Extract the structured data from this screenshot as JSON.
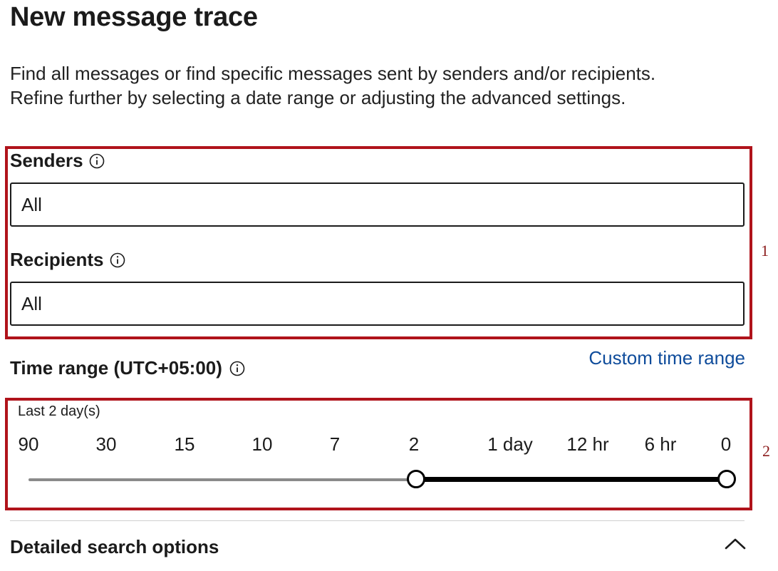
{
  "page_title": "New message trace",
  "description": {
    "line1": "Find all messages or find specific messages sent by senders and/or recipients.",
    "line2": "Refine further by selecting a date range or adjusting the advanced settings."
  },
  "senders": {
    "label": "Senders",
    "value": "All"
  },
  "recipients": {
    "label": "Recipients",
    "value": "All"
  },
  "time_range": {
    "label": "Time range (UTC+05:00)",
    "custom_link": "Custom time range",
    "selected_text": "Last 2 day(s)",
    "ticks": [
      "90",
      "30",
      "15",
      "10",
      "7",
      "2",
      "1 day",
      "12 hr",
      "6 hr",
      "0"
    ],
    "selected_start": "2",
    "selected_end": "0"
  },
  "detailed_search": {
    "label": "Detailed search options",
    "icon": "chevron-up-icon"
  },
  "callouts": {
    "one": "1",
    "two": "2"
  },
  "colors": {
    "callout_border": "#b0131b",
    "link": "#0f4c9b"
  }
}
